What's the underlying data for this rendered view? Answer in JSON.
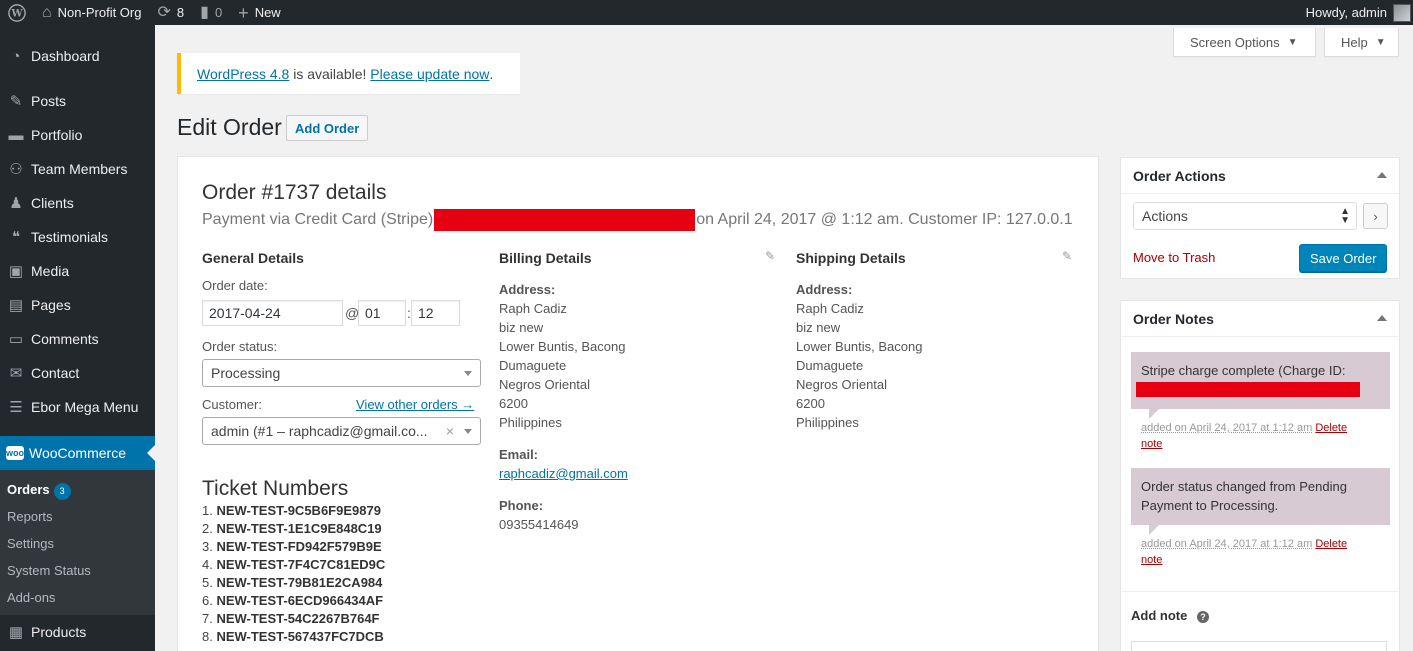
{
  "adminbar": {
    "site_name": "Non-Profit Org",
    "updates_count": "8",
    "comments_count": "0",
    "new_label": "New",
    "howdy": "Howdy, admin"
  },
  "sidebar": {
    "items": [
      {
        "label": "Dashboard",
        "icon": "dashboard-icon"
      },
      {
        "label": "Posts",
        "icon": "pin-icon"
      },
      {
        "label": "Portfolio",
        "icon": "folder-icon"
      },
      {
        "label": "Team Members",
        "icon": "team-icon"
      },
      {
        "label": "Clients",
        "icon": "person-icon"
      },
      {
        "label": "Testimonials",
        "icon": "quote-icon"
      },
      {
        "label": "Media",
        "icon": "media-icon"
      },
      {
        "label": "Pages",
        "icon": "pages-icon"
      },
      {
        "label": "Comments",
        "icon": "comment-icon"
      },
      {
        "label": "Contact",
        "icon": "mail-icon"
      },
      {
        "label": "Ebor Mega Menu",
        "icon": "menu-icon"
      },
      {
        "label": "WooCommerce",
        "icon": "woo-icon"
      },
      {
        "label": "Products",
        "icon": "box-icon"
      }
    ],
    "woo_submenu": [
      {
        "label": "Orders",
        "badge": "3"
      },
      {
        "label": "Reports"
      },
      {
        "label": "Settings"
      },
      {
        "label": "System Status"
      },
      {
        "label": "Add-ons"
      }
    ]
  },
  "screen_options": "Screen Options",
  "help": "Help",
  "notice": {
    "link1": "WordPress 4.8",
    "text": " is available! ",
    "link2": "Please update now",
    "end": "."
  },
  "page": {
    "title": "Edit Order",
    "add_order": "Add Order"
  },
  "order": {
    "title": "Order #1737 details",
    "meta_prefix": "Payment via Credit Card (Stripe)",
    "meta_suffix": "on April 24, 2017 @ 1:12 am. Customer IP: 127.0.0.1",
    "general": {
      "heading": "General Details",
      "date_label": "Order date:",
      "date": "2017-04-24",
      "at": "@",
      "hour": "01",
      "colon": ":",
      "minute": "12",
      "status_label": "Order status:",
      "status": "Processing",
      "customer_label": "Customer:",
      "view_other": "View other orders →",
      "customer": "admin (#1 – raphcadiz@gmail.co..."
    },
    "billing": {
      "heading": "Billing Details",
      "address_label": "Address:",
      "address": [
        "Raph Cadiz",
        "biz new",
        "Lower Buntis, Bacong",
        "Dumaguete",
        "Negros Oriental",
        "6200",
        "Philippines"
      ],
      "email_label": "Email:",
      "email": "raphcadiz@gmail.com",
      "phone_label": "Phone:",
      "phone": "09355414649"
    },
    "shipping": {
      "heading": "Shipping Details",
      "address_label": "Address:",
      "address": [
        "Raph Cadiz",
        "biz new",
        "Lower Buntis, Bacong",
        "Dumaguete",
        "Negros Oriental",
        "6200",
        "Philippines"
      ]
    },
    "tickets_title": "Ticket Numbers",
    "tickets": [
      {
        "n": "1.",
        "code": "NEW-TEST-9C5B6F9E9879"
      },
      {
        "n": "2.",
        "code": "NEW-TEST-1E1C9E848C19"
      },
      {
        "n": "3.",
        "code": "NEW-TEST-FD942F579B9E"
      },
      {
        "n": "4.",
        "code": "NEW-TEST-7F4C7C81ED9C"
      },
      {
        "n": "5.",
        "code": "NEW-TEST-79B81E2CA984"
      },
      {
        "n": "6.",
        "code": "NEW-TEST-6ECD966434AF"
      },
      {
        "n": "7.",
        "code": "NEW-TEST-54C2267B764F"
      },
      {
        "n": "8.",
        "code": "NEW-TEST-567437FC7DCB"
      }
    ]
  },
  "actions_box": {
    "title": "Order Actions",
    "select": "Actions",
    "trash": "Move to Trash",
    "save": "Save Order"
  },
  "notes_box": {
    "title": "Order Notes",
    "notes": [
      {
        "text": "Stripe charge complete (Charge ID:",
        "added": "added on April 24, 2017 at 1:12 am",
        "delete": "Delete note"
      },
      {
        "text": "Order status changed from Pending Payment to Processing.",
        "added": "added on April 24, 2017 at 1:12 am",
        "delete": "Delete note"
      }
    ],
    "add_note": "Add note"
  }
}
